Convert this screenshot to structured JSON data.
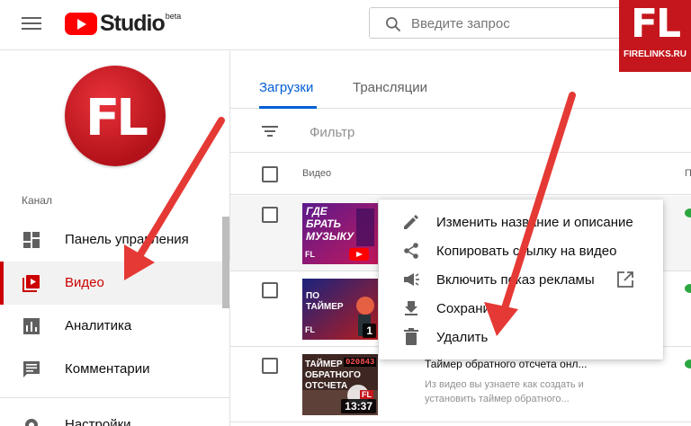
{
  "header": {
    "logo_text": "Studio",
    "logo_badge": "beta",
    "search_placeholder": "Введите запрос"
  },
  "watermark": {
    "logo": "FL",
    "site": "FIRELINKS.RU"
  },
  "sidebar": {
    "avatar_text": "FL",
    "section_label": "Канал",
    "items": [
      {
        "label": "Панель управления",
        "icon": "dashboard-icon",
        "active": false
      },
      {
        "label": "Видео",
        "icon": "video-library-icon",
        "active": true
      },
      {
        "label": "Аналитика",
        "icon": "analytics-icon",
        "active": false
      },
      {
        "label": "Комментарии",
        "icon": "comments-icon",
        "active": false
      },
      {
        "label": "Настройки",
        "icon": "settings-icon",
        "active": false
      }
    ]
  },
  "tabs": [
    {
      "label": "Загрузки",
      "active": true
    },
    {
      "label": "Трансляции",
      "active": false
    }
  ],
  "filter": {
    "placeholder": "Фильтр"
  },
  "table": {
    "column_video": "Видео",
    "column_right": "П",
    "rows": [
      {
        "thumb_lines": [
          "ГДЕ",
          "БРАТЬ",
          "МУЗЫКУ"
        ],
        "thumb_badge": "FL",
        "duration": "",
        "title": "",
        "desc": ""
      },
      {
        "thumb_lines": [
          "ПО",
          "ТАЙМЕР"
        ],
        "thumb_badge": "FL",
        "duration": "1",
        "title": "",
        "desc": ""
      },
      {
        "thumb_lines": [
          "ТАЙМЕР",
          "ОБРАТНОГО",
          "ОТСЧЕТА"
        ],
        "thumb_badge": "FL",
        "counter": "020843",
        "duration": "13:37",
        "title": "Таймер обратного отсчета онл...",
        "desc": "Из видео вы узнаете как создать и установить таймер обратного..."
      }
    ]
  },
  "menu": {
    "items": [
      {
        "label": "Изменить название и описание",
        "icon": "pencil-icon"
      },
      {
        "label": "Копировать ссылку на видео",
        "icon": "share-icon"
      },
      {
        "label": "Включить показ рекламы",
        "icon": "megaphone-icon",
        "external": "open-in-new-icon"
      },
      {
        "label": "Сохранить",
        "icon": "download-icon"
      },
      {
        "label": "Удалить",
        "icon": "trash-icon"
      }
    ]
  },
  "colors": {
    "brand_red": "#ff0000",
    "active_red": "#cc0000",
    "tab_blue": "#065fd4",
    "arrow_red": "#e53935",
    "visible_green": "#2ba640"
  }
}
